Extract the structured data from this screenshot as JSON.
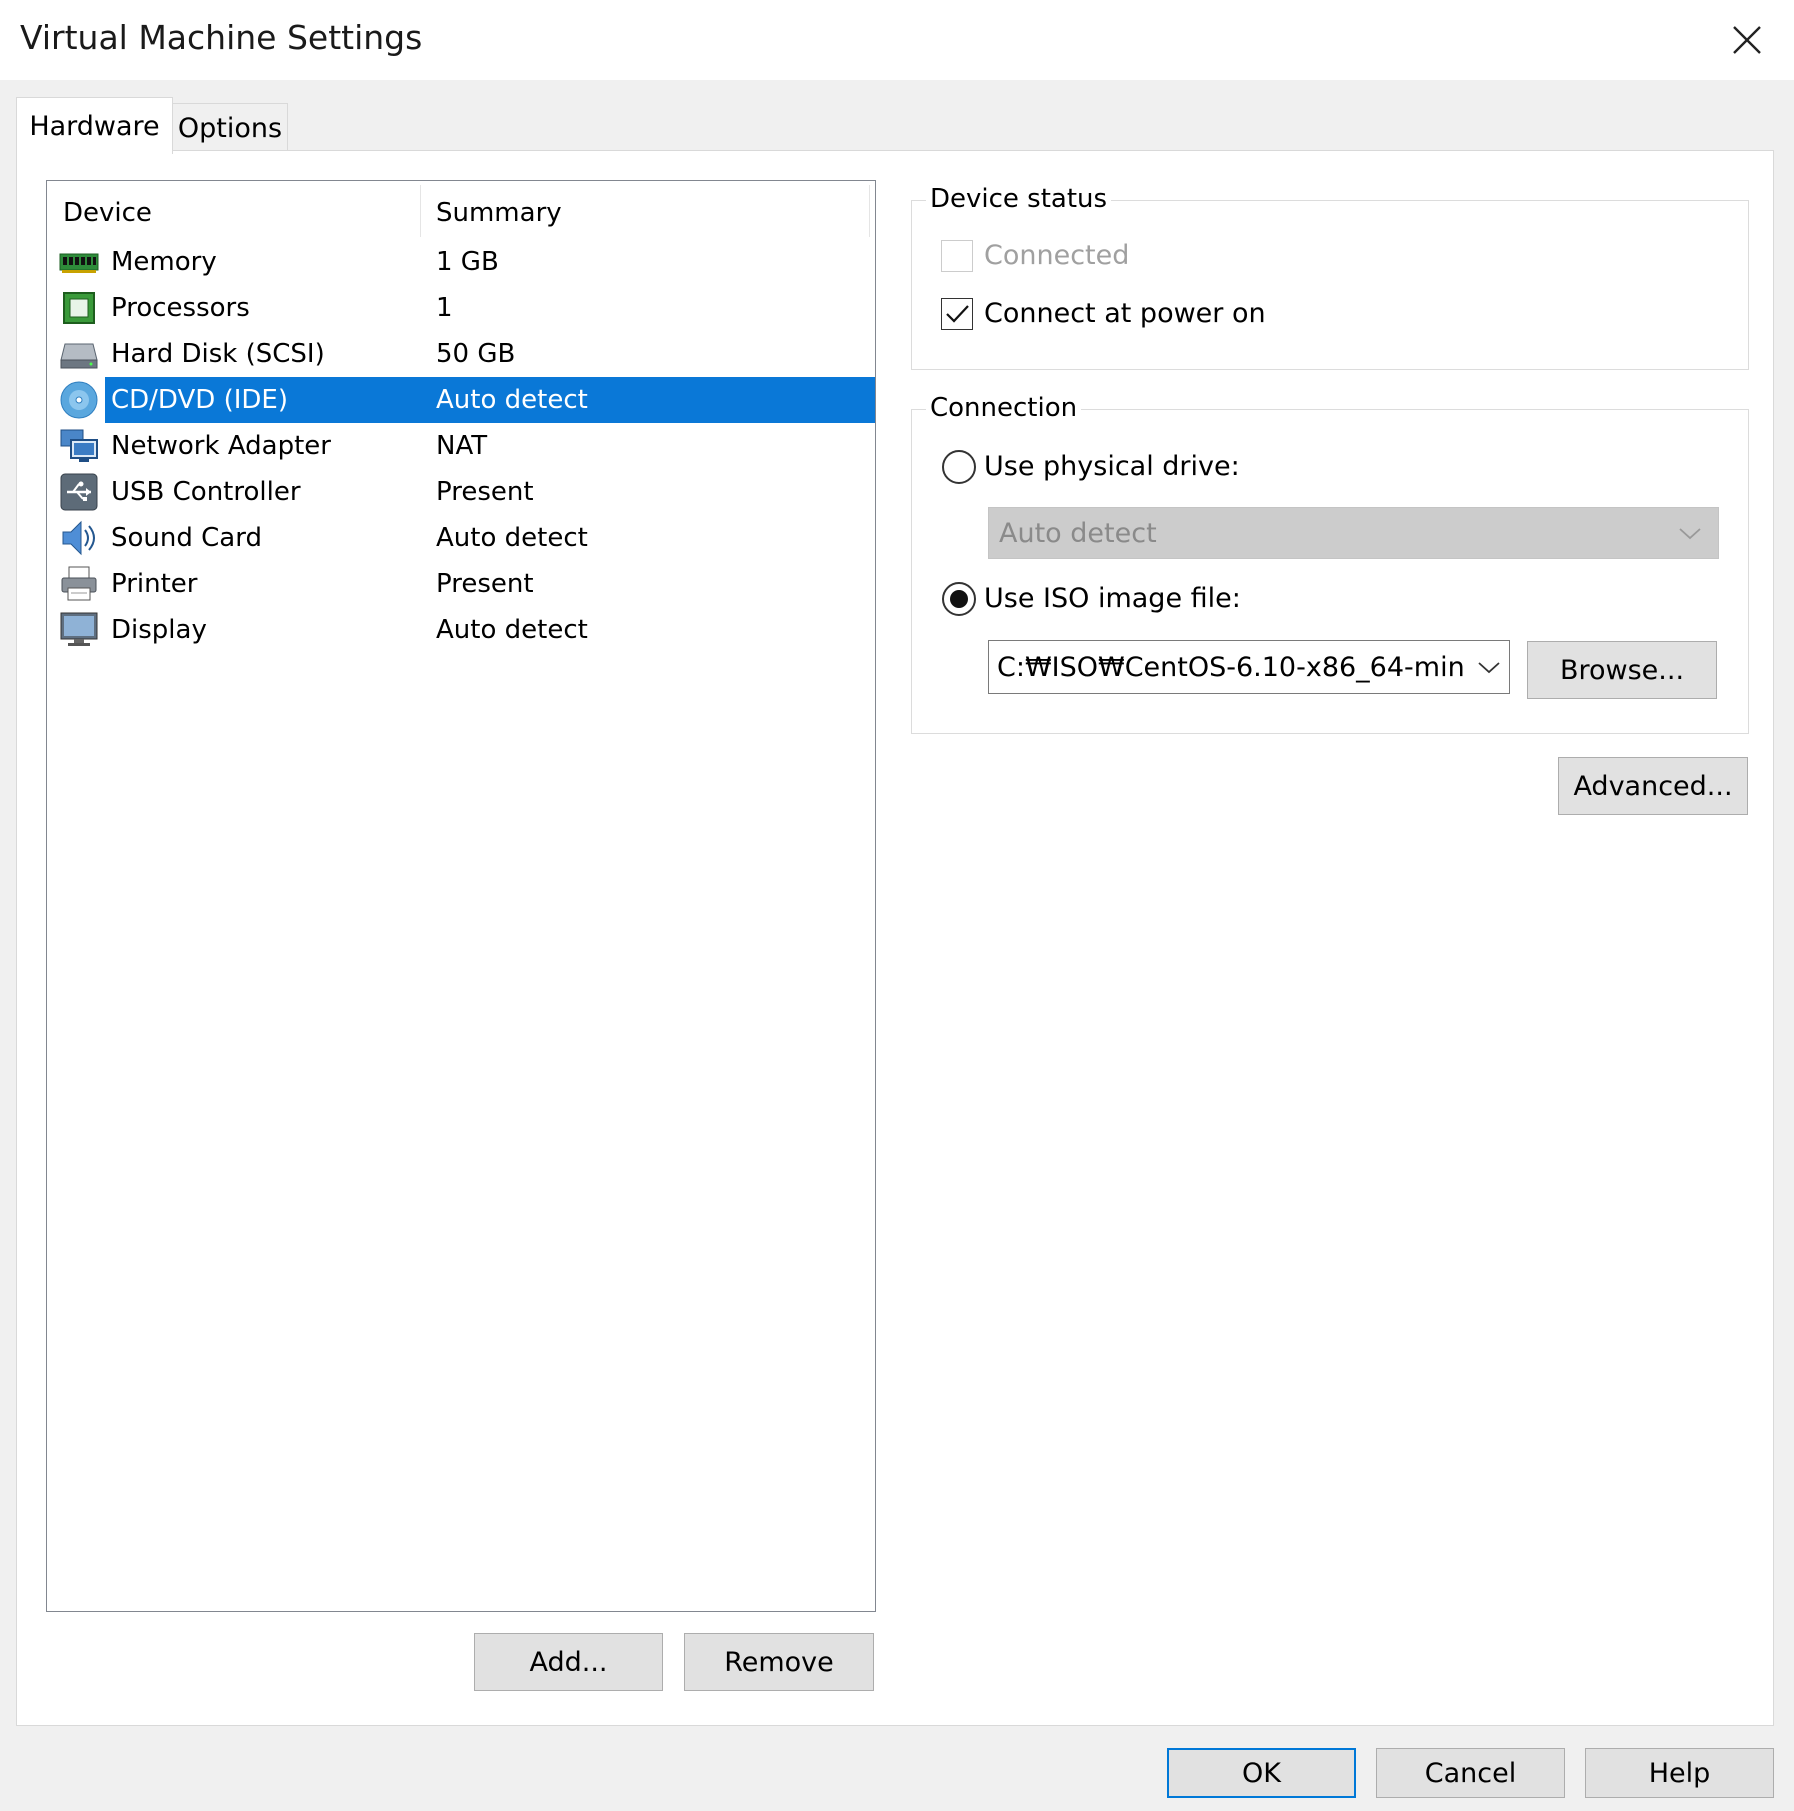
{
  "window": {
    "title": "Virtual Machine Settings"
  },
  "tabs": [
    {
      "label": "Hardware",
      "active": true
    },
    {
      "label": "Options",
      "active": false
    }
  ],
  "device_list": {
    "columns": [
      "Device",
      "Summary"
    ],
    "rows": [
      {
        "device": "Memory",
        "summary": "1 GB",
        "icon": "memory-icon"
      },
      {
        "device": "Processors",
        "summary": "1",
        "icon": "processor-icon"
      },
      {
        "device": "Hard Disk (SCSI)",
        "summary": "50 GB",
        "icon": "hard-disk-icon"
      },
      {
        "device": "CD/DVD (IDE)",
        "summary": "Auto detect",
        "icon": "cd-dvd-icon",
        "selected": true
      },
      {
        "device": "Network Adapter",
        "summary": "NAT",
        "icon": "network-adapter-icon"
      },
      {
        "device": "USB Controller",
        "summary": "Present",
        "icon": "usb-icon"
      },
      {
        "device": "Sound Card",
        "summary": "Auto detect",
        "icon": "sound-card-icon"
      },
      {
        "device": "Printer",
        "summary": "Present",
        "icon": "printer-icon"
      },
      {
        "device": "Display",
        "summary": "Auto detect",
        "icon": "display-icon"
      }
    ]
  },
  "list_buttons": {
    "add": "Add...",
    "remove": "Remove"
  },
  "device_status": {
    "title": "Device status",
    "connected": {
      "label": "Connected",
      "checked": false,
      "disabled": true
    },
    "connect_at_power_on": {
      "label": "Connect at power on",
      "checked": true
    }
  },
  "connection": {
    "title": "Connection",
    "physical_drive": {
      "label": "Use physical drive:",
      "selected": false,
      "value": "Auto detect"
    },
    "iso_image": {
      "label": "Use ISO image file:",
      "selected": true,
      "value": "C:₩ISO₩CentOS-6.10-x86_64-min"
    },
    "browse": "Browse..."
  },
  "advanced": "Advanced...",
  "footer": {
    "ok": "OK",
    "cancel": "Cancel",
    "help": "Help"
  },
  "colors": {
    "selection": "#0a78d7",
    "ok_border": "#0078d7"
  }
}
